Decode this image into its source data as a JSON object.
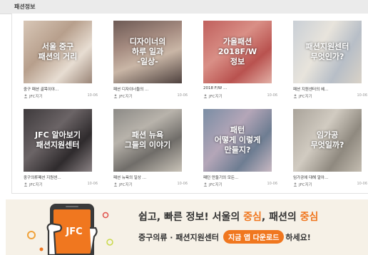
{
  "section": {
    "title": "패션정보"
  },
  "cards": [
    {
      "overlay": "서울 중구\n패션의 거리",
      "caption": "중구 패션 골목이야…",
      "author": "JFC지기",
      "date": "10-06"
    },
    {
      "overlay": "디자이너의\n하루 일과\n-일상-",
      "caption": "패션 디자이너들의 …",
      "author": "JFC지기",
      "date": "10-06"
    },
    {
      "overlay": "가을패션\n2018F/W\n정보",
      "caption": "2018 F/W …",
      "author": "JFC지기",
      "date": "10-06"
    },
    {
      "overlay": "패션지원센터\n무엇인가?",
      "caption": "패션 지원센터의 혜…",
      "author": "JFC지기",
      "date": "10-06"
    },
    {
      "overlay": "JFC 알아보기\n패션지원센터",
      "caption": "중구의류패션 지원센…",
      "author": "JFC지기",
      "date": "10-06"
    },
    {
      "overlay": "패션 뉴욕\n그들의 이야기",
      "caption": "패션 뉴욕의 일상 …",
      "author": "JFC지기",
      "date": "10-06"
    },
    {
      "overlay": "패턴\n어떻게 이렇게\n만들지?",
      "caption": "패턴 만들기의 모든…",
      "author": "JFC지기",
      "date": "10-06"
    },
    {
      "overlay": "임가공\n무엇일까?",
      "caption": "임가공에 대해 알아…",
      "author": "JFC지기",
      "date": "10-06"
    }
  ],
  "banner": {
    "logo": "JFC",
    "line1": [
      "쉽고, 빠른 정보! 서울의 ",
      "중심",
      ", 패션의 ",
      "중심"
    ],
    "line2_prefix": "중구의류 · 패션지원센터",
    "line2_pill": "지금 앱 다운로드",
    "line2_suffix": "하세요!"
  },
  "colors": {
    "accent": "#f0771f",
    "banner_bg": "#f6f1e7",
    "header_bg": "#ebebeb"
  }
}
